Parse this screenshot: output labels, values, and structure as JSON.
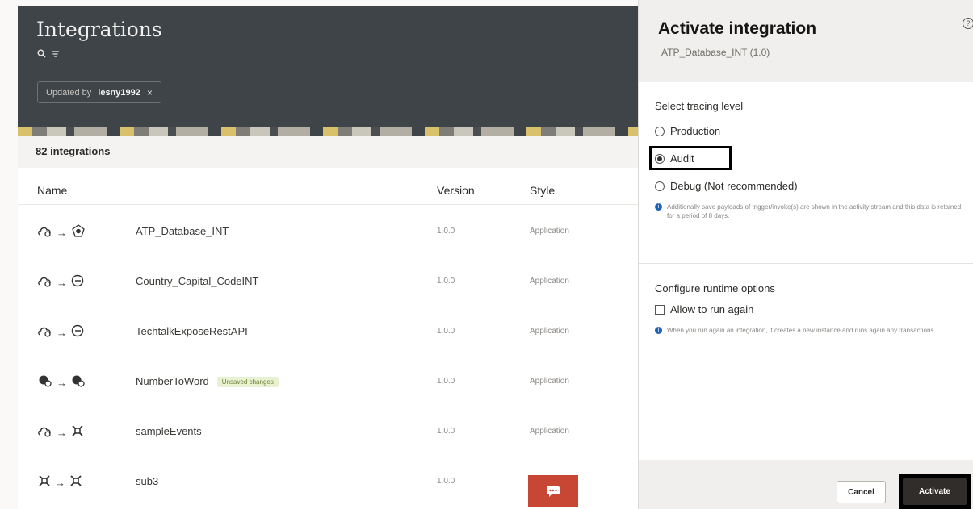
{
  "header": {
    "title": "Integrations",
    "filter_prefix": "Updated by",
    "filter_value": "lesny1992",
    "filter_remove": "×"
  },
  "list": {
    "count_label": "82 integrations",
    "columns": {
      "name": "Name",
      "version": "Version",
      "style": "Style"
    },
    "rows": [
      {
        "name": "ATP_Database_INT",
        "version": "1.0.0",
        "style": "Application",
        "badge": ""
      },
      {
        "name": "Country_Capital_CodeINT",
        "version": "1.0.0",
        "style": "Application",
        "badge": ""
      },
      {
        "name": "TechtalkExposeRestAPI",
        "version": "1.0.0",
        "style": "Application",
        "badge": ""
      },
      {
        "name": "NumberToWord",
        "version": "1.0.0",
        "style": "Application",
        "badge": "Unsaved changes"
      },
      {
        "name": "sampleEvents",
        "version": "1.0.0",
        "style": "Application",
        "badge": ""
      },
      {
        "name": "sub3",
        "version": "1.0.0",
        "style": "",
        "badge": ""
      }
    ]
  },
  "drawer": {
    "title": "Activate integration",
    "subtitle": "ATP_Database_INT (1.0)",
    "tracing_label": "Select tracing level",
    "tracing_options": [
      "Production",
      "Audit",
      "Debug (Not recommended)"
    ],
    "tracing_selected": "Audit",
    "debug_info": "Additionally save payloads of trigger/invoke(s) are shown in the activity stream and this data is retained for a period of 8 days.",
    "runtime_label": "Configure runtime options",
    "allow_run_again": "Allow to run again",
    "run_again_info": "When you run again an integration, it creates a new instance and runs again any transactions.",
    "cancel_label": "Cancel",
    "activate_label": "Activate"
  },
  "colors": {
    "header_bg": "#3f4448",
    "activate_bg": "#312d2a",
    "badge_green": "#6f7e36",
    "style_icon_red": "#c74634"
  }
}
